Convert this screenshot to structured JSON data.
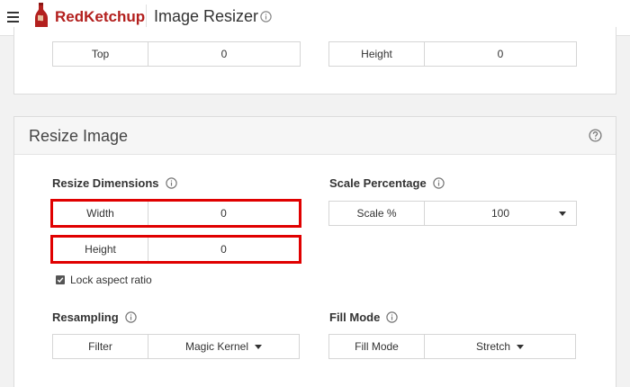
{
  "header": {
    "brand": "RedKetchup",
    "app_title": "Image Resizer",
    "brand_color": "#b3201e"
  },
  "top_card": {
    "top_label": "Top",
    "top_value": "0",
    "height_label": "Height",
    "height_value": "0"
  },
  "resize_card": {
    "title": "Resize Image",
    "resize_dimensions": {
      "heading": "Resize Dimensions",
      "width_label": "Width",
      "width_value": "0",
      "height_label": "Height",
      "height_value": "0",
      "lock_label": "Lock aspect ratio",
      "lock_checked": true
    },
    "scale_percentage": {
      "heading": "Scale Percentage",
      "label": "Scale %",
      "value": "100"
    },
    "resampling": {
      "heading": "Resampling",
      "label": "Filter",
      "value": "Magic Kernel"
    },
    "fill_mode": {
      "heading": "Fill Mode",
      "label": "Fill Mode",
      "value": "Stretch"
    }
  },
  "icons": {
    "menu": "hamburger-icon",
    "logo": "ketchup-bottle-icon",
    "info": "info-icon",
    "help": "help-circle-icon",
    "dropdown": "caret-down-icon",
    "checkbox": "check-icon"
  }
}
